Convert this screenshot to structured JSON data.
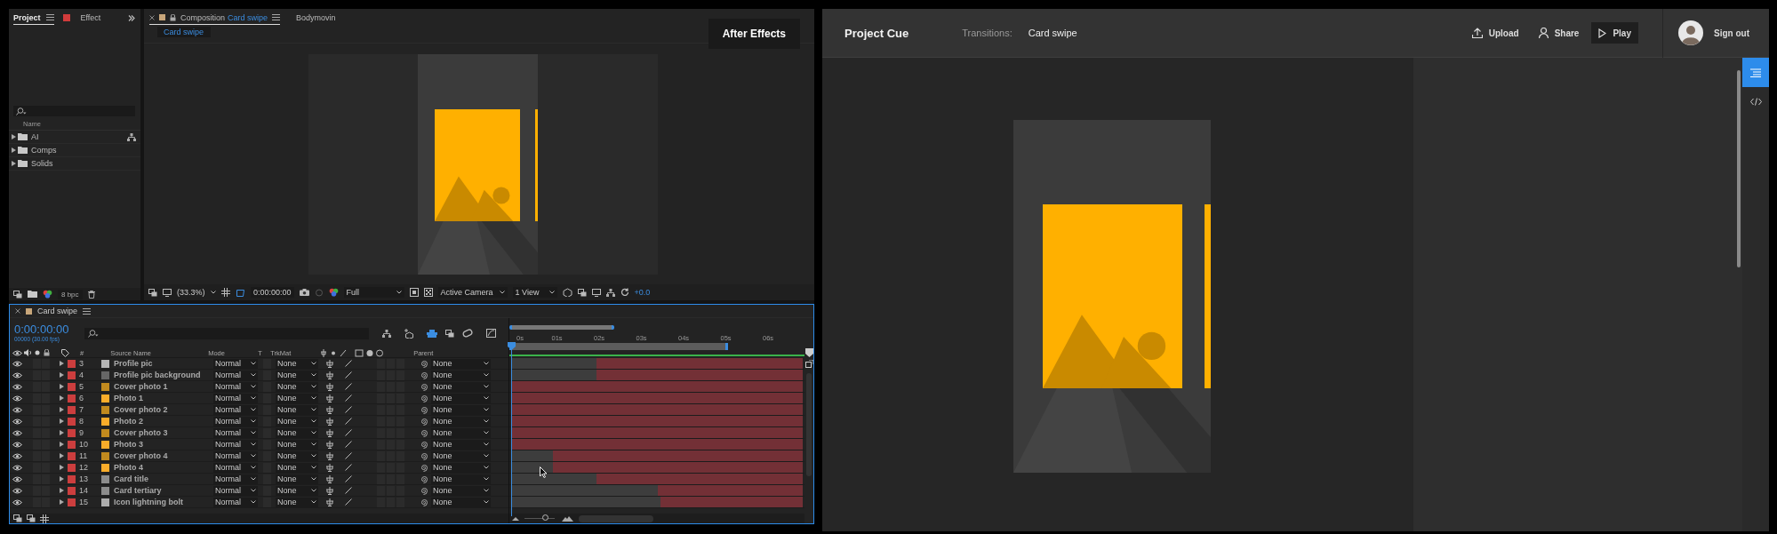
{
  "after_effects": {
    "project_panel": {
      "tabs": [
        {
          "label": "Project",
          "selected": true
        },
        {
          "label": "Effect",
          "selected": false
        }
      ],
      "column": "Name",
      "folders": [
        {
          "name": "AI"
        },
        {
          "name": "Comps"
        },
        {
          "name": "Solids"
        }
      ],
      "bit_depth": "8 bpc"
    },
    "composition_panel": {
      "tabs": [
        {
          "kind": "composition",
          "prefix": "Composition",
          "label": "Card swipe",
          "selected": true
        },
        {
          "kind": "panel",
          "label": "Bodymovin",
          "selected": false
        }
      ],
      "breadcrumb": "Card swipe",
      "badge": "After Effects",
      "toolbar": {
        "magnification": "(33.3%)",
        "timecode": "0:00:00:00",
        "resolution": "Full",
        "camera": "Active Camera",
        "views": "1 View",
        "exposure": "+0.0"
      }
    },
    "timeline": {
      "title": "Card swipe",
      "zoom": {
        "level": 0.7
      },
      "timecode": "0:00:00:00",
      "frame_info": "00000 (30.00 fps)",
      "columns": [
        "#",
        "Source Name",
        "Mode",
        "T",
        "TrkMat",
        "Parent"
      ],
      "ruler": [
        "0s",
        "01s",
        "02s",
        "03s",
        "04s",
        "05s",
        "06s"
      ],
      "layers": [
        {
          "number": "3",
          "name": "Profile pic",
          "color": "#b5b5b5",
          "mode": "Normal",
          "track_matte": "None",
          "parent": "None",
          "level": 0.71
        },
        {
          "number": "4",
          "name": "Profile pic background",
          "color": "#666666",
          "mode": "Normal",
          "track_matte": "None",
          "parent": "None",
          "level": 0.71
        },
        {
          "number": "5",
          "name": "Cover photo 1",
          "color": "#c18a1e",
          "mode": "Normal",
          "track_matte": "None",
          "parent": "None",
          "level": 1
        },
        {
          "number": "6",
          "name": "Photo 1",
          "color": "#f9ac2a",
          "mode": "Normal",
          "track_matte": "None",
          "parent": "None",
          "level": 1
        },
        {
          "number": "7",
          "name": "Cover photo 2",
          "color": "#c18a1e",
          "mode": "Normal",
          "track_matte": "None",
          "parent": "None",
          "level": 1
        },
        {
          "number": "8",
          "name": "Photo 2",
          "color": "#f9ac2a",
          "mode": "Normal",
          "track_matte": "None",
          "parent": "None",
          "level": 1
        },
        {
          "number": "9",
          "name": "Cover photo 3",
          "color": "#c18a1e",
          "mode": "Normal",
          "track_matte": "None",
          "parent": "None",
          "level": 1
        },
        {
          "number": "10",
          "name": "Photo 3",
          "color": "#f9ac2a",
          "mode": "Normal",
          "track_matte": "None",
          "parent": "None",
          "level": 1
        },
        {
          "number": "11",
          "name": "Cover photo 4",
          "color": "#c18a1e",
          "mode": "Normal",
          "track_matte": "None",
          "parent": "None",
          "level": 0.86
        },
        {
          "number": "12",
          "name": "Photo 4",
          "color": "#f9ac2a",
          "mode": "Normal",
          "track_matte": "None",
          "parent": "None",
          "level": 0.86
        },
        {
          "number": "13",
          "name": "Card title",
          "color": "#8c8c8c",
          "mode": "Normal",
          "track_matte": "None",
          "parent": "None",
          "level": 0.71
        },
        {
          "number": "14",
          "name": "Card tertiary",
          "color": "#8c8c8c",
          "mode": "Normal",
          "track_matte": "None",
          "parent": "None",
          "level": 0.5
        },
        {
          "number": "15",
          "name": "Icon lightning bolt",
          "color": "#adadad",
          "mode": "Normal",
          "track_matte": "None",
          "parent": "None",
          "level": 0.49
        }
      ]
    }
  },
  "web_app": {
    "brand": "Project Cue",
    "breadcrumb_label": "Transitions:",
    "breadcrumb_value": "Card swipe",
    "actions": [
      {
        "kind": "upload",
        "label": "Upload"
      },
      {
        "kind": "share",
        "label": "Share"
      },
      {
        "kind": "play",
        "label": "Play"
      }
    ],
    "account": "Sign out",
    "rail": [
      {
        "kind": "list",
        "selected": true
      },
      {
        "kind": "code",
        "selected": false
      }
    ]
  }
}
